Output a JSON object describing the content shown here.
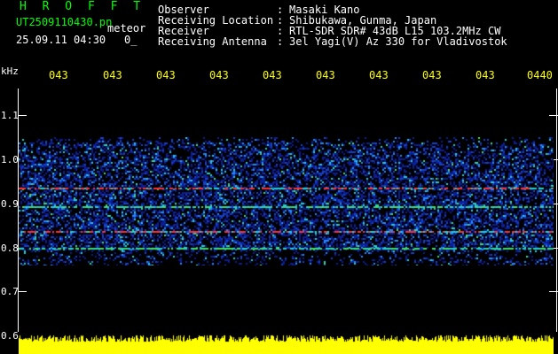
{
  "header": {
    "title": "H R O F F T",
    "filename": "UT2509110430.pn",
    "meteor_label": "meteor",
    "datetime": "25.09.11 04:30",
    "value": "0_"
  },
  "meta": [
    {
      "label": "Observer",
      "sep": ":",
      "value": "Masaki Kano"
    },
    {
      "label": "Receiving Location",
      "sep": ":",
      "value": "Shibukawa, Gunma, Japan"
    },
    {
      "label": "Receiver",
      "sep": ":",
      "value": "RTL-SDR SDR# 43dB L15 103.2MHz CW"
    },
    {
      "label": "Receiving Antenna",
      "sep": ":",
      "value": "3el Yagi(V) Az 330 for Vladivostok"
    }
  ],
  "axis": {
    "unit": "kHz",
    "freq_labels": [
      "1.1",
      "1.0",
      "0.9",
      "0.8",
      "0.7",
      "0.6"
    ],
    "time_labels": [
      "043",
      "043",
      "043",
      "043",
      "043",
      "043",
      "043",
      "043",
      "043",
      "0440"
    ]
  },
  "colors": {
    "header_green": "#00ff00",
    "axis_yellow": "#ffff00",
    "text_white": "#ffffff"
  }
}
